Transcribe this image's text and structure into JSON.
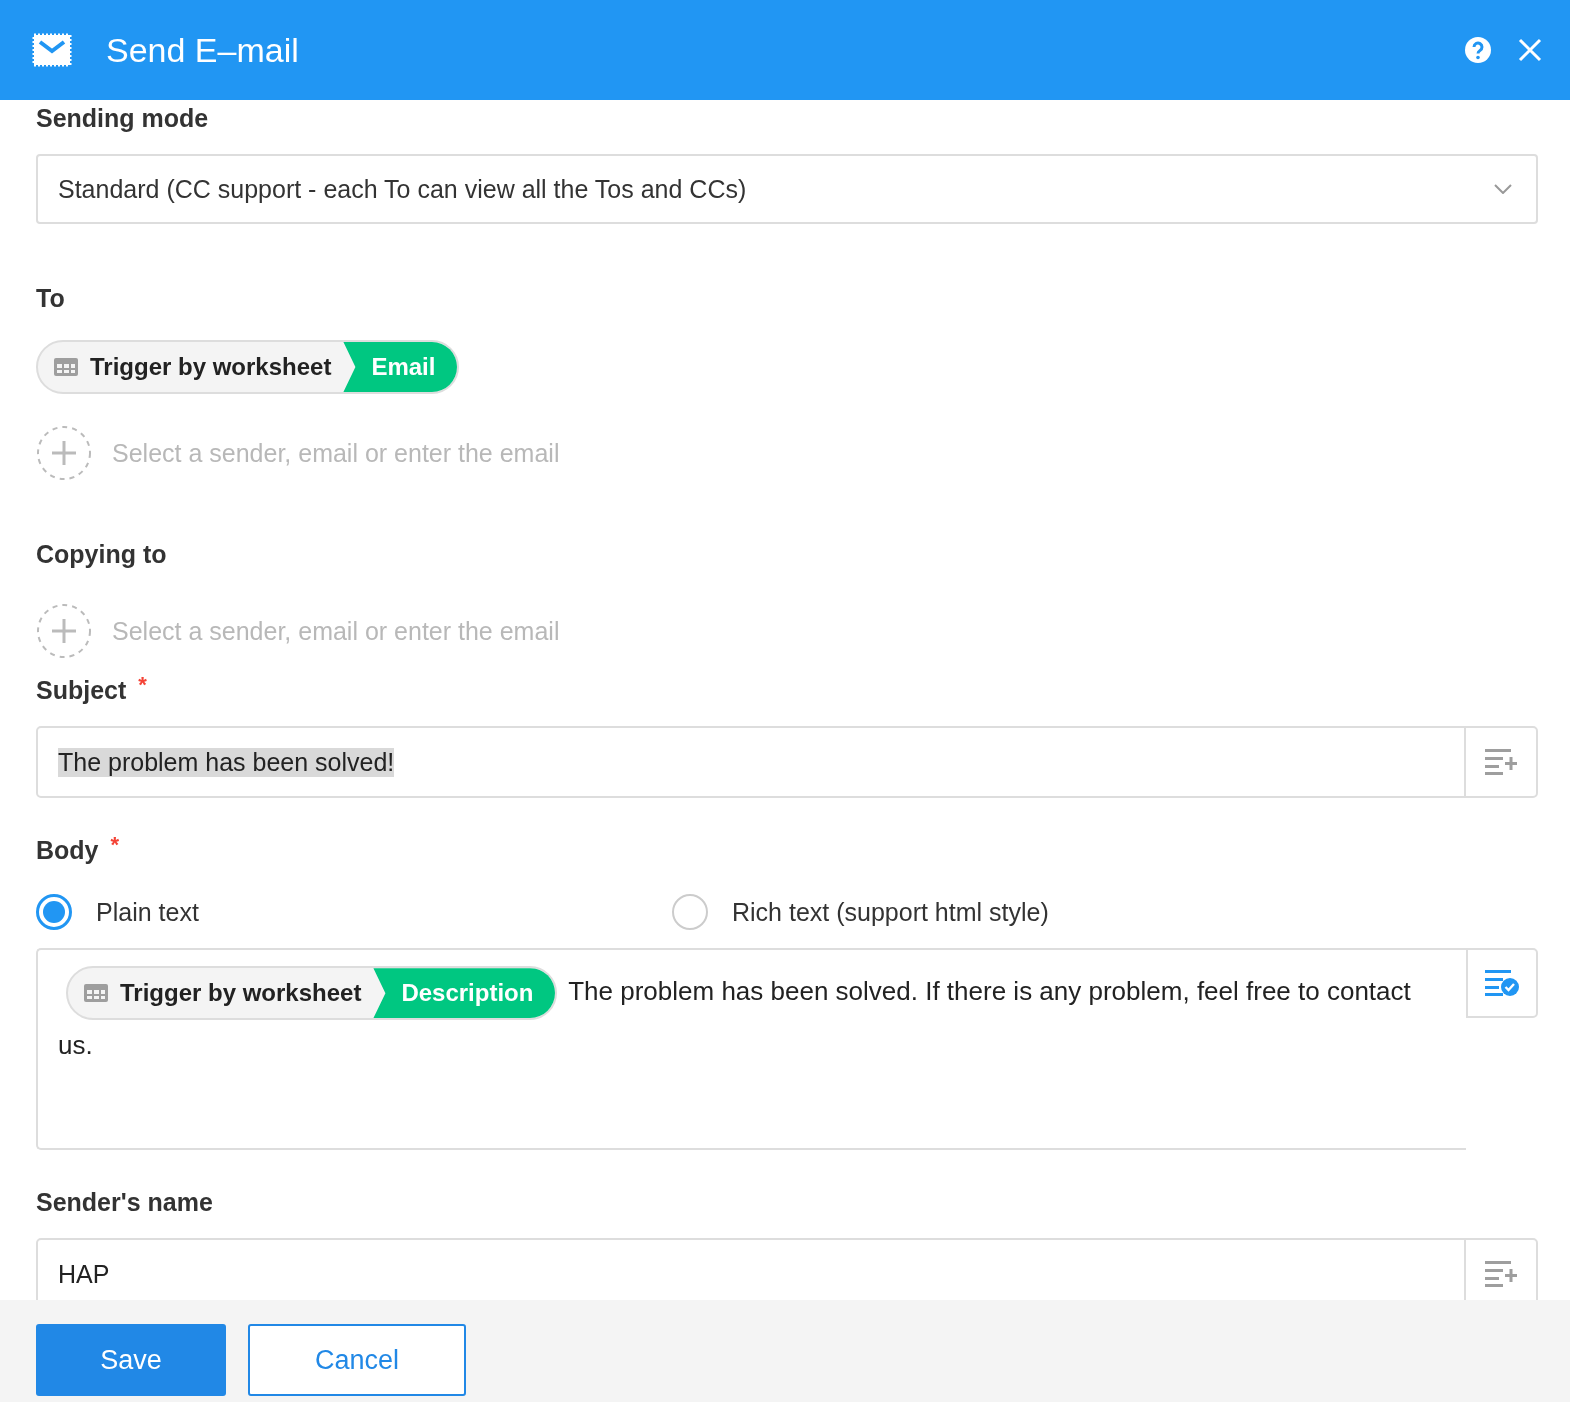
{
  "window": {
    "title": "Send E–mail"
  },
  "sending_mode": {
    "label": "Sending mode",
    "value": "Standard (CC support - each To can view all the Tos and CCs)"
  },
  "to": {
    "label": "To",
    "tokens": [
      {
        "source": "Trigger by worksheet",
        "field": "Email"
      }
    ],
    "placeholder": "Select a sender, email or enter the email"
  },
  "copying_to": {
    "label": "Copying to",
    "placeholder": "Select a sender, email or enter the email"
  },
  "subject": {
    "label": "Subject",
    "required_mark": "*",
    "value": "The problem has been solved!",
    "text_selected": true
  },
  "body": {
    "label": "Body",
    "required_mark": "*",
    "formats": [
      {
        "label": "Plain text",
        "selected": true
      },
      {
        "label": "Rich text (support html style)",
        "selected": false
      }
    ],
    "token": {
      "source": "Trigger by worksheet",
      "field": "Description"
    },
    "text": "The problem has been solved. If there is any problem, feel free to contact us."
  },
  "senders_name": {
    "label": "Sender's name",
    "value": "HAP"
  },
  "buttons": [
    {
      "label": "Save",
      "kind": "primary"
    },
    {
      "label": "Cancel",
      "kind": "secondary"
    }
  ]
}
